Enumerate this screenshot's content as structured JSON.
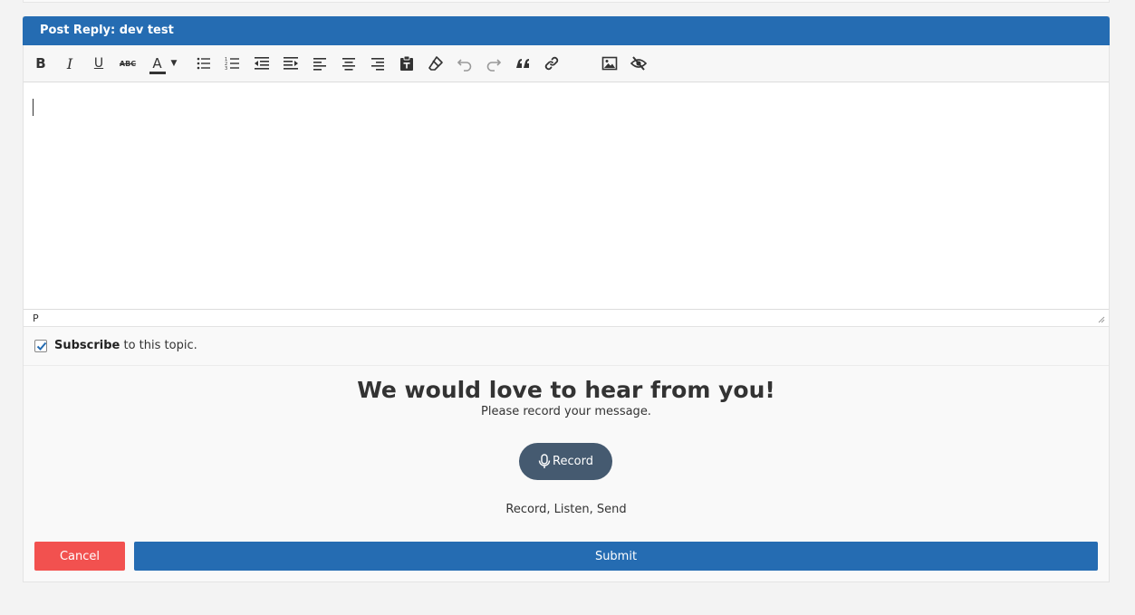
{
  "header": {
    "title": "Post Reply: dev test"
  },
  "toolbar": {
    "bold": "B",
    "italic": "I",
    "underline": "U",
    "strikethrough": "ABC",
    "text_color": "A"
  },
  "editor": {
    "path": "P"
  },
  "subscribe": {
    "bold": "Subscribe",
    "rest": " to this topic.",
    "checked": true
  },
  "voice": {
    "heading": "We would love to hear from you!",
    "subheading": "Please record your message.",
    "record_label": "Record",
    "hint": "Record, Listen, Send"
  },
  "actions": {
    "cancel": "Cancel",
    "submit": "Submit"
  },
  "colors": {
    "primary": "#256cb2",
    "danger": "#f2514f",
    "record": "#455a70"
  }
}
